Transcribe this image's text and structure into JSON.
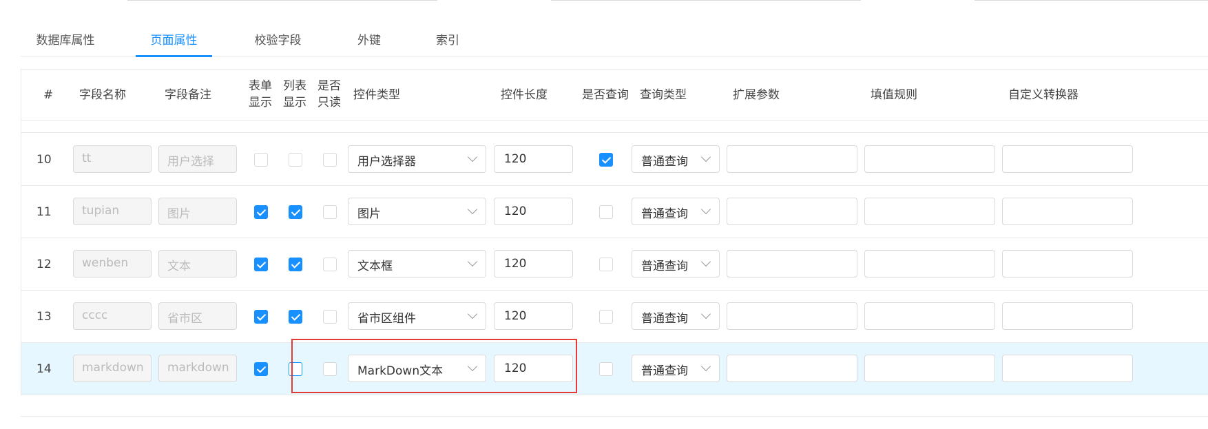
{
  "tabs": [
    {
      "label": "数据库属性",
      "active": false
    },
    {
      "label": "页面属性",
      "active": true
    },
    {
      "label": "校验字段",
      "active": false
    },
    {
      "label": "外键",
      "active": false
    },
    {
      "label": "索引",
      "active": false
    }
  ],
  "columns": {
    "num": "#",
    "field_name": "字段名称",
    "field_remark": "字段备注",
    "form_show_1": "表单",
    "form_show_2": "显示",
    "list_show_1": "列表",
    "list_show_2": "显示",
    "readonly_1": "是否",
    "readonly_2": "只读",
    "control_type": "控件类型",
    "control_length": "控件长度",
    "is_query": "是否查询",
    "query_type": "查询类型",
    "ext_params": "扩展参数",
    "fill_rule": "填值规则",
    "custom_converter": "自定义转换器"
  },
  "rows": [
    {
      "num": "10",
      "name": "tt",
      "remark": "用户选择",
      "form_show": false,
      "list_show": false,
      "readonly": false,
      "control": "用户选择器",
      "length": "120",
      "query": true,
      "query_type": "普通查询",
      "ext": "",
      "fill": "",
      "conv": "",
      "selected": false
    },
    {
      "num": "11",
      "name": "tupian",
      "remark": "图片",
      "form_show": true,
      "list_show": true,
      "readonly": false,
      "control": "图片",
      "length": "120",
      "query": false,
      "query_type": "普通查询",
      "ext": "",
      "fill": "",
      "conv": "",
      "selected": false
    },
    {
      "num": "12",
      "name": "wenben",
      "remark": "文本",
      "form_show": true,
      "list_show": true,
      "readonly": false,
      "control": "文本框",
      "length": "120",
      "query": false,
      "query_type": "普通查询",
      "ext": "",
      "fill": "",
      "conv": "",
      "selected": false
    },
    {
      "num": "13",
      "name": "cccc",
      "remark": "省市区",
      "form_show": true,
      "list_show": true,
      "readonly": false,
      "control": "省市区组件",
      "length": "120",
      "query": false,
      "query_type": "普通查询",
      "ext": "",
      "fill": "",
      "conv": "",
      "selected": false
    },
    {
      "num": "14",
      "name": "markdown",
      "remark": "markdown",
      "form_show": true,
      "list_show": false,
      "readonly": false,
      "control": "MarkDown文本",
      "length": "120",
      "query": false,
      "query_type": "普通查询",
      "ext": "",
      "fill": "",
      "conv": "",
      "selected": true
    }
  ],
  "colors": {
    "accent": "#1890ff",
    "selected_row": "#e6f7ff",
    "highlight_border": "#e53935"
  }
}
